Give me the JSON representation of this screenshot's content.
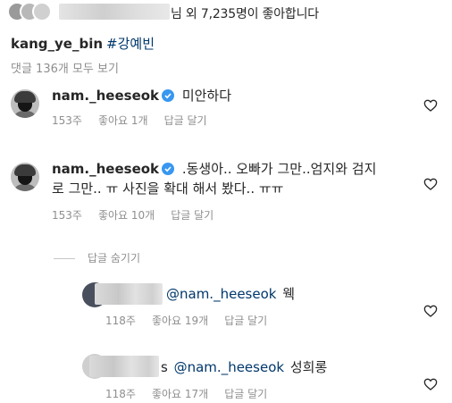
{
  "likes": {
    "suffix_text": "님 외 7,235명이 좋아합니다"
  },
  "caption": {
    "username": "kang_ye_bin",
    "hashtag": "#강예빈"
  },
  "view_all_comments": "댓글 136개 모두 보기",
  "comments": [
    {
      "username": "nam._heeseok",
      "verified": true,
      "text": "미안하다",
      "time": "153주",
      "likes": "좋아요 1개",
      "reply": "답글 달기"
    },
    {
      "username": "nam._heeseok",
      "verified": true,
      "text_line1": ".동생아.. 오빠가 그만..엄지와 검지",
      "text_line2": "로 그만.. ㅠ  사진을 확대 해서 봤다.. ㅠㅠ",
      "time": "153주",
      "likes": "좋아요 10개",
      "reply": "답글 달기"
    }
  ],
  "hide_replies": "답글 숨기기",
  "replies": [
    {
      "mention": "@nam._heeseok",
      "text": "웩",
      "time": "118주",
      "likes": "좋아요 19개",
      "reply": "답글 달기"
    },
    {
      "prefix": "s",
      "mention": "@nam._heeseok",
      "text": "성희롱",
      "time": "118주",
      "likes": "좋아요 17개",
      "reply": "답글 달기"
    }
  ],
  "icons": {
    "heart": "heart-outline-icon",
    "verified": "verified-badge-icon"
  },
  "colors": {
    "link": "#00376b",
    "muted": "#8e8e8e",
    "verified": "#3897f0"
  }
}
